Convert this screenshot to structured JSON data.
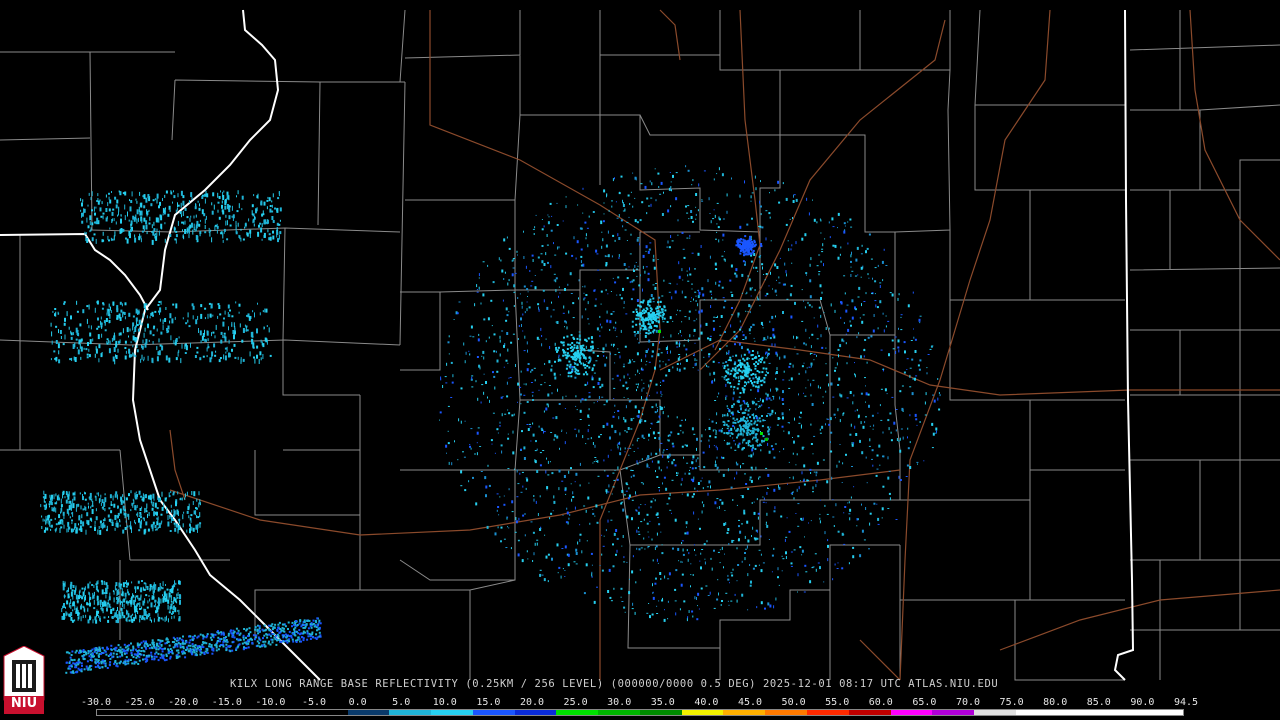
{
  "map": {
    "radar_site": "KILX",
    "caption": "KILX LONG RANGE BASE REFLECTIVITY (0.25KM / 256 LEVEL) (000000/0000 0.5 DEG) 2025-12-01 08:17 UTC  ATLAS.NIU.EDU",
    "background_color": "#000000",
    "county_line_color": "#8a8a8a",
    "state_line_color": "#ffffff",
    "road_color": "#8b4a2b"
  },
  "legend": {
    "scale_values": [
      "-30.0",
      "-25.0",
      "-20.0",
      "-15.0",
      "-10.0",
      "-5.0",
      "0.0",
      "5.0",
      "10.0",
      "15.0",
      "20.0",
      "25.0",
      "30.0",
      "35.0",
      "40.0",
      "45.0",
      "50.0",
      "55.0",
      "60.0",
      "65.0",
      "70.0",
      "75.0",
      "80.0",
      "85.0",
      "90.0",
      "94.5"
    ],
    "colors": [
      "#000000",
      "#000000",
      "#000000",
      "#000000",
      "#000000",
      "#000000",
      "#0a3a6a",
      "#1fb3d6",
      "#26d0f0",
      "#1a56ff",
      "#0a2bd8",
      "#00e000",
      "#00b400",
      "#008a00",
      "#f2f200",
      "#ffb000",
      "#ff7a00",
      "#ff2a00",
      "#c00000",
      "#ff00ff",
      "#b000d8",
      "#e0e0e0",
      "#ffffff",
      "#ffffff",
      "#ffffff",
      "#ffffff"
    ]
  },
  "logo": {
    "text": "NIU",
    "name": "niu-logo"
  }
}
